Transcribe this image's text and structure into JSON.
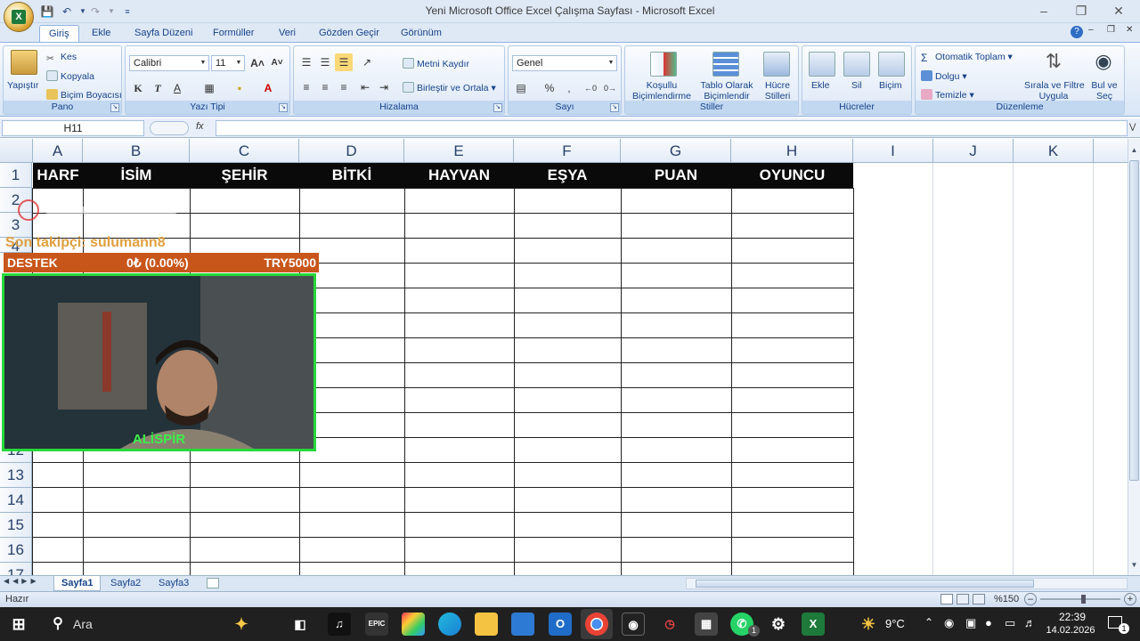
{
  "window": {
    "title": "Yeni Microsoft Office Excel Çalışma Sayfası - Microsoft Excel"
  },
  "ribbon": {
    "tabs": [
      "Giriş",
      "Ekle",
      "Sayfa Düzeni",
      "Formüller",
      "Veri",
      "Gözden Geçir",
      "Görünüm"
    ],
    "active_tab": "Giriş",
    "groups": {
      "pano": {
        "label": "Pano",
        "paste": "Yapıştır",
        "cut": "Kes",
        "copy": "Kopyala",
        "format_painter": "Biçim Boyacısı"
      },
      "font": {
        "label": "Yazı Tipi",
        "font_name": "Calibri",
        "font_size": "11"
      },
      "alignment": {
        "label": "Hizalama",
        "wrap": "Metni Kaydır",
        "merge": "Birleştir ve Ortala"
      },
      "number": {
        "label": "Sayı",
        "format": "Genel"
      },
      "styles": {
        "label": "Stiller",
        "conditional_1": "Koşullu",
        "conditional_2": "Biçimlendirme",
        "table_1": "Tablo Olarak",
        "table_2": "Biçimlendir",
        "cell_1": "Hücre",
        "cell_2": "Stilleri"
      },
      "cells": {
        "label": "Hücreler",
        "insert": "Ekle",
        "delete": "Sil",
        "format": "Biçim"
      },
      "editing": {
        "label": "Düzenleme",
        "autosum": "Otomatik Toplam",
        "fill": "Dolgu",
        "clear": "Temizle",
        "sort_1": "Sırala ve Filtre",
        "sort_2": "Uygula",
        "find_1": "Bul ve",
        "find_2": "Seç"
      }
    }
  },
  "formula_bar": {
    "name_box": "H11",
    "fx": "fx",
    "content": ""
  },
  "grid": {
    "columns": [
      "A",
      "B",
      "C",
      "D",
      "E",
      "F",
      "G",
      "H",
      "I",
      "J",
      "K"
    ],
    "rows": [
      "1",
      "2",
      "3",
      "4",
      "12",
      "13",
      "14",
      "15",
      "16",
      "17"
    ],
    "header_row": [
      "HARF",
      "İSİM",
      "ŞEHİR",
      "BİTKİ",
      "HAYVAN",
      "EŞYA",
      "PUAN",
      "OYUNCU"
    ]
  },
  "sheets": {
    "tabs": [
      "Sayfa1",
      "Sayfa2",
      "Sayfa3"
    ],
    "active": "Sayfa1"
  },
  "status": {
    "ready": "Hazır",
    "zoom": "%150"
  },
  "overlay": {
    "follower": "Son takipçi: sulumann8",
    "support_label": "DESTEK",
    "support_amount": "0₺ (0.00%)",
    "support_goal": "TRY5000",
    "streamer_name": "ALİSPİR"
  },
  "taskbar": {
    "search_placeholder": "Ara",
    "weather": "9°C",
    "time": "22:39",
    "date": "14.02.2026",
    "whatsapp_badge": "1",
    "notif_badge": "1"
  },
  "colors": {
    "excel_blue": "#15428b",
    "header_fill": "#0a0a0a",
    "support_bar": "#c8561a",
    "cam_frame": "#27d83a",
    "follower_text": "#e0a040"
  }
}
